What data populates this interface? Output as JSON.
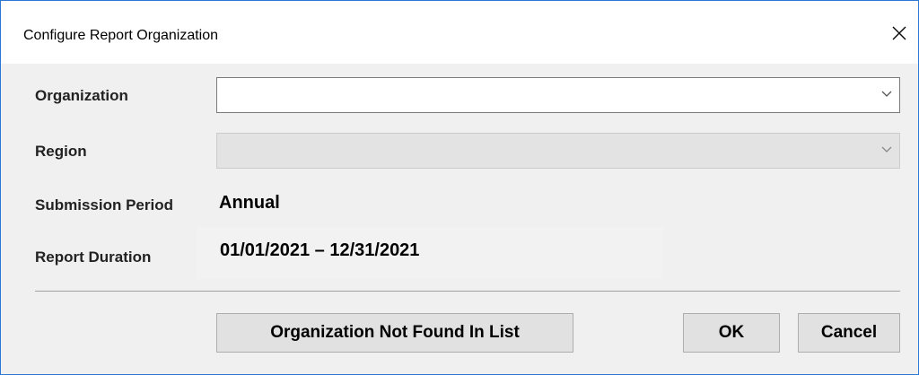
{
  "window": {
    "title": "Configure Report Organization",
    "accent_color": "#2b78d4"
  },
  "form": {
    "organization": {
      "label": "Organization",
      "value": ""
    },
    "region": {
      "label": "Region",
      "value": "",
      "enabled": false
    },
    "submission_period": {
      "label": "Submission Period",
      "value": "Annual"
    },
    "report_duration": {
      "label": "Report Duration",
      "value": "01/01/2021 – 12/31/2021"
    }
  },
  "buttons": {
    "not_found_label": "Organization Not Found In List",
    "ok_label": "OK",
    "cancel_label": "Cancel"
  },
  "icons": {
    "close": "close-icon",
    "dropdown": "chevron-down-icon"
  }
}
